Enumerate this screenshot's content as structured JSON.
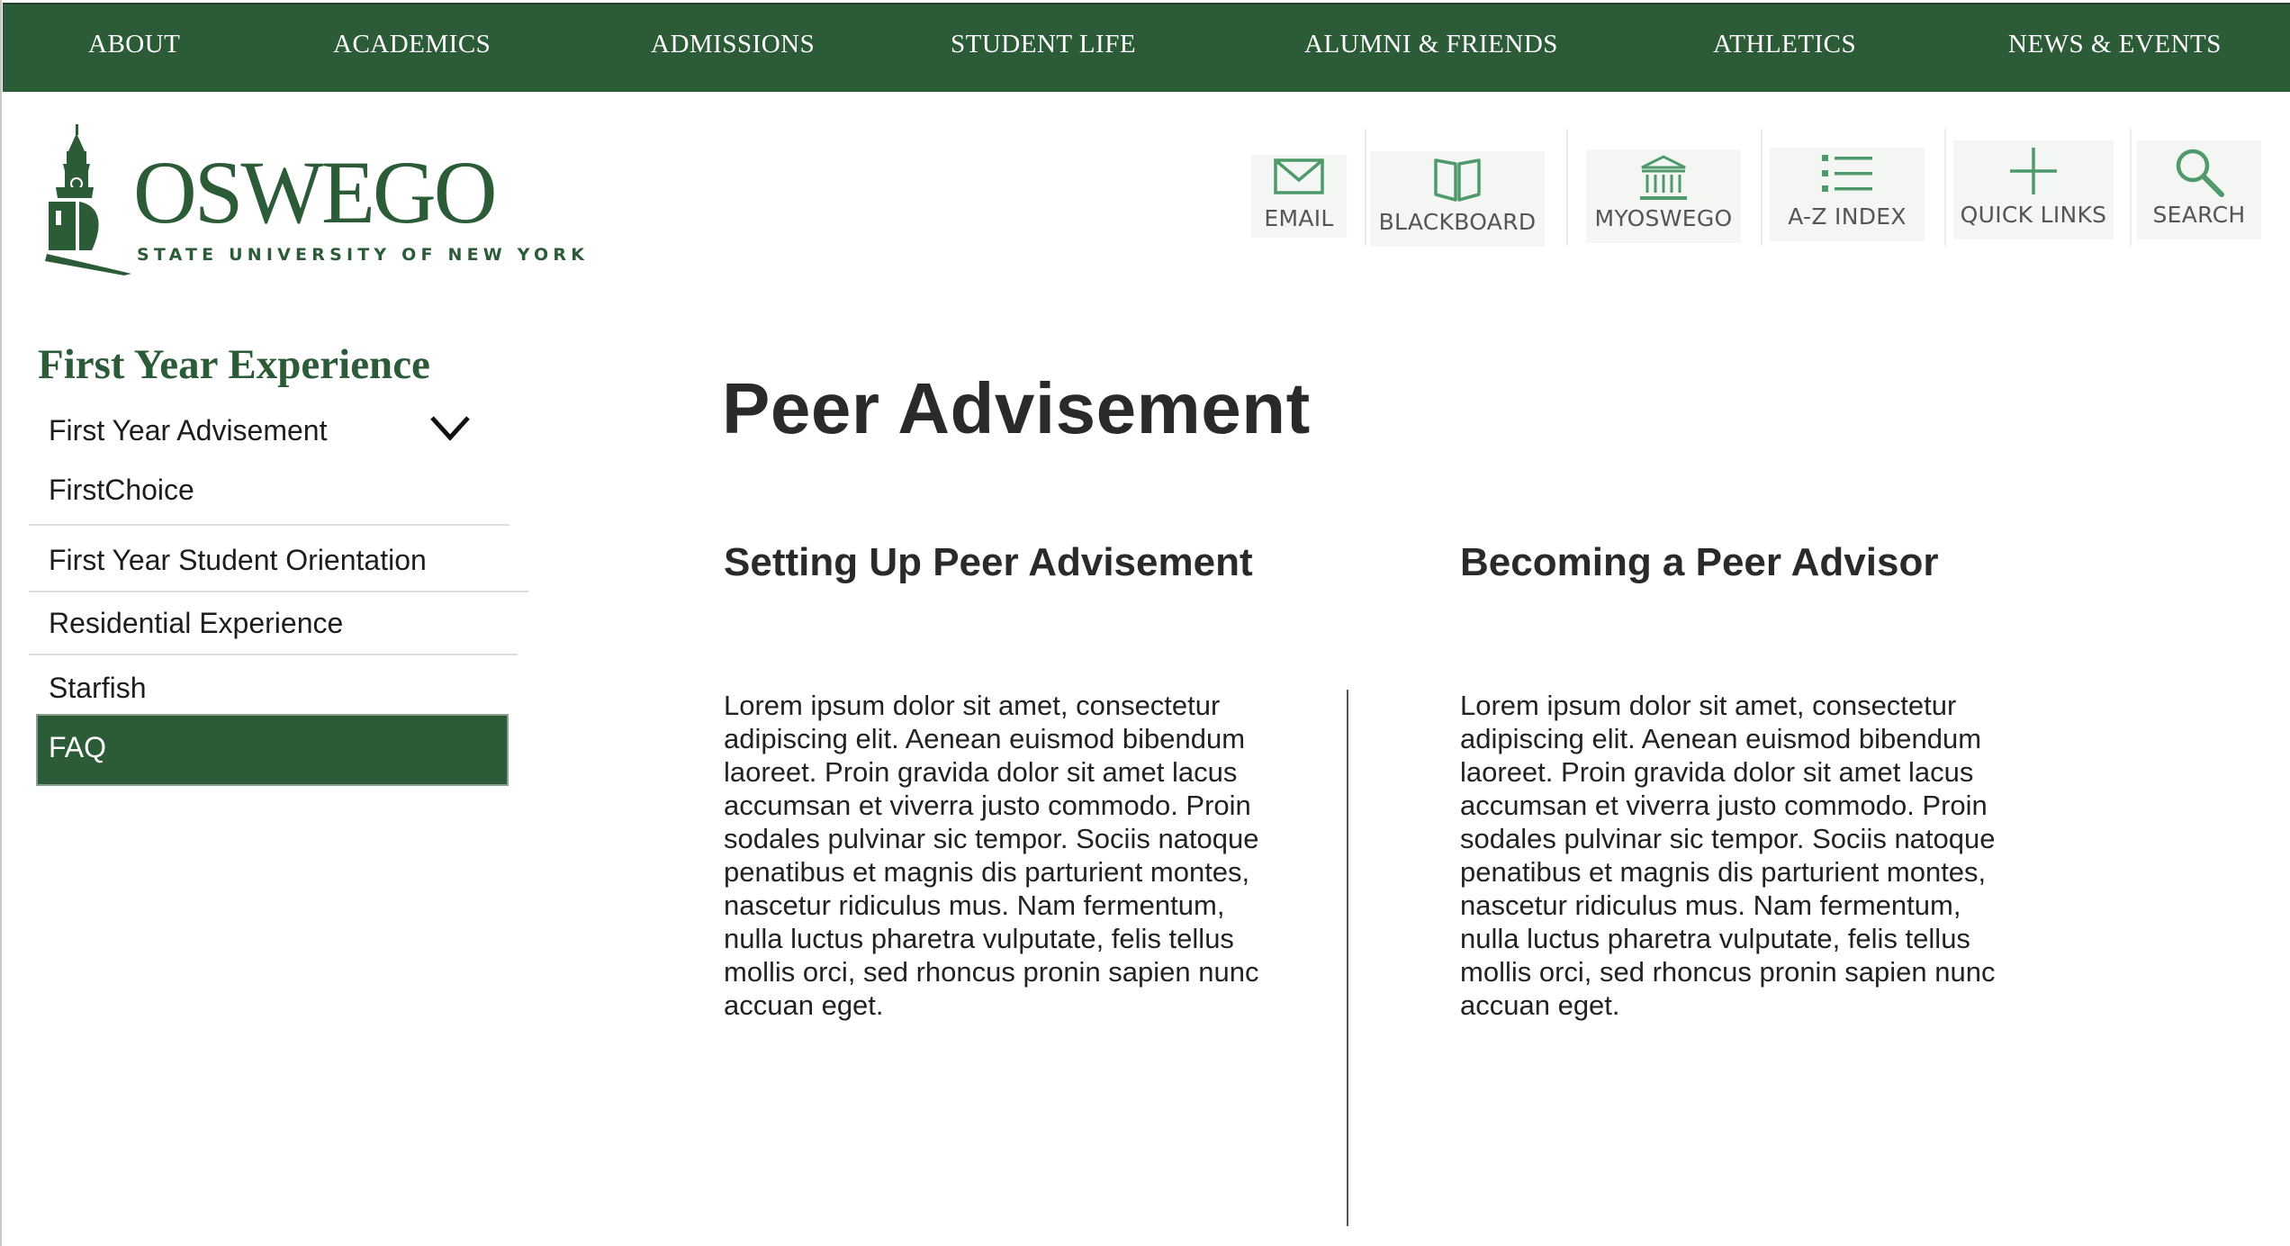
{
  "top_nav": {
    "items": [
      "ABOUT",
      "ACADEMICS",
      "ADMISSIONS",
      "STUDENT LIFE",
      "ALUMNI & FRIENDS",
      "ATHLETICS",
      "NEWS & EVENTS"
    ]
  },
  "logo": {
    "wordmark": "OSWEGO",
    "subtitle": "STATE UNIVERSITY OF NEW YORK"
  },
  "toolbar": {
    "email": "EMAIL",
    "blackboard": "BLACKBOARD",
    "myoswego": "MYOSWEGO",
    "az_index": "A-Z INDEX",
    "quick_links": "QUICK LINKS",
    "search": "SEARCH"
  },
  "sidebar": {
    "title": "First Year Experience",
    "items": [
      "First Year Advisement",
      "FirstChoice",
      "First Year Student Orientation",
      "Residential Experience",
      "Starfish",
      "FAQ"
    ]
  },
  "main": {
    "title": "Peer Advisement",
    "columns": [
      {
        "heading": "Setting Up Peer Advisement",
        "body": "Lorem ipsum dolor sit amet, consectetur adipiscing elit. Aenean euismod bibendum laoreet. Proin gravida dolor sit amet lacus accumsan et viverra justo commodo. Proin sodales pulvinar sic tempor. Sociis natoque penatibus et magnis dis parturient montes, nascetur ridiculus mus. Nam fermentum, nulla luctus pharetra vulputate, felis tellus mollis orci, sed rhoncus pronin sapien nunc accuan eget."
      },
      {
        "heading": "Becoming a Peer Advisor",
        "body": "Lorem ipsum dolor sit amet, consectetur adipiscing elit. Aenean euismod bibendum laoreet. Proin gravida dolor sit amet lacus accumsan et viverra justo commodo. Proin sodales pulvinar sic tempor. Sociis natoque penatibus et magnis dis parturient montes, nascetur ridiculus mus. Nam fermentum, nulla luctus pharetra vulputate, felis tellus mollis orci, sed rhoncus pronin sapien nunc accuan eget."
      }
    ]
  },
  "colors": {
    "brand_green": "#2c5b37",
    "icon_green": "#4f9a6b",
    "text_dark": "#2a2a2a"
  },
  "icons": {
    "email": "envelope-icon",
    "blackboard": "open-book-icon",
    "myoswego": "building-columns-icon",
    "az_index": "list-icon",
    "quick_links": "plus-icon",
    "search": "magnifier-icon",
    "expand": "chevron-down-icon"
  }
}
